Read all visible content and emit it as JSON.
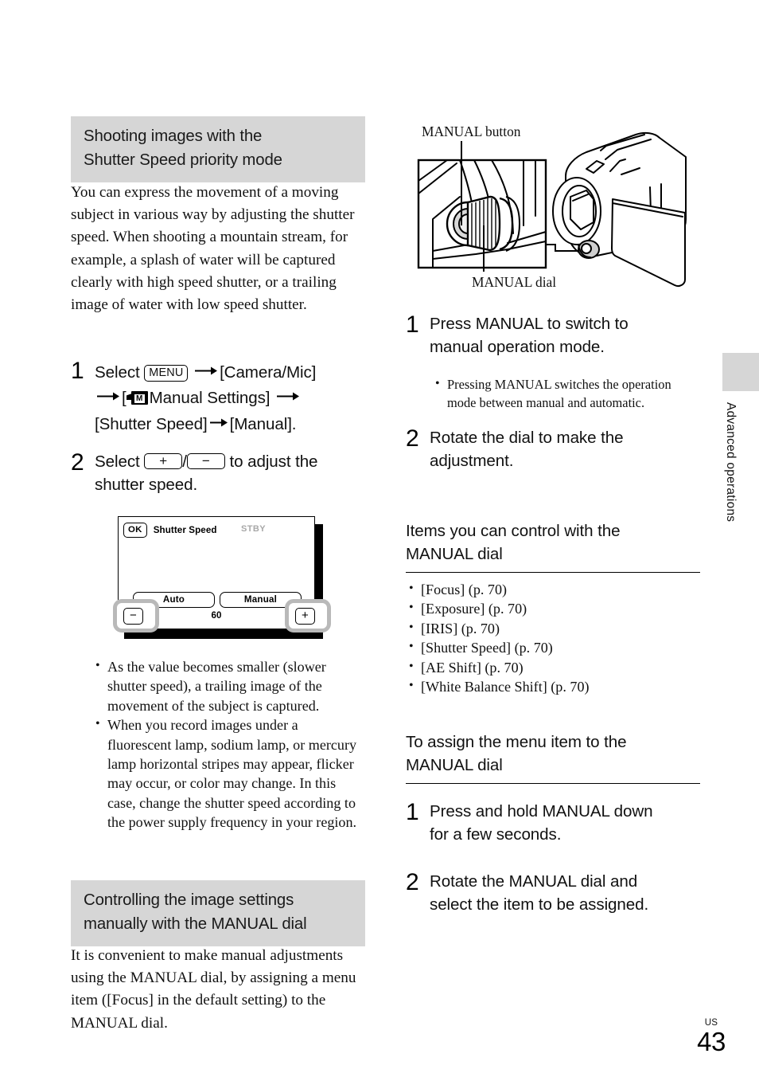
{
  "page": {
    "region": "US",
    "number": "43",
    "side_tab": "Advanced operations"
  },
  "left_column": {
    "heading1": {
      "line1": "Shooting images with the",
      "line2": "Shutter Speed priority mode"
    },
    "intro_paragraph": "You can express the movement of a moving subject in various way by adjusting the shutter speed. When shooting a mountain stream, for example, a splash of water will be captured clearly with high speed shutter, or a trailing image of water with low speed shutter.",
    "steps": [
      {
        "number": "1",
        "select_label": "Select",
        "menu_key": "MENU",
        "item1": "[Camera/Mic]",
        "icon_letter": "M",
        "item2": "Manual Settings]",
        "item3": "[Shutter Speed]",
        "item4": "[Manual]."
      },
      {
        "number": "2",
        "select_label": "Select",
        "plus_key": "+",
        "minus_key": "−",
        "tail_line1": "to adjust the",
        "tail_line2": "shutter speed."
      }
    ],
    "lcd_screen": {
      "ok_button": "OK",
      "title": "Shutter Speed",
      "status": "STBY",
      "mode_auto": "Auto",
      "mode_manual": "Manual",
      "value": "60",
      "decrease_button": "−",
      "increase_button": "+"
    },
    "notes": [
      "As the value becomes smaller (slower shutter speed), a trailing image of the movement of the subject is captured.",
      "When you record images under a fluorescent lamp, sodium lamp, or mercury lamp horizontal stripes may appear, flicker may occur, or color may change. In this case, change the shutter speed according to the power supply frequency in your region."
    ],
    "heading2": {
      "line1": "Controlling the image settings",
      "line2": "manually with the MANUAL dial"
    },
    "closing_paragraph": "It is convenient to make manual adjustments using the MANUAL dial, by assigning a menu item ([Focus] in the default setting) to the MANUAL dial."
  },
  "right_column": {
    "figure": {
      "label_top": "MANUAL button",
      "label_bottom": "MANUAL dial"
    },
    "steps": [
      {
        "number": "1",
        "line1": "Press MANUAL to switch to",
        "line2": "manual operation mode."
      },
      {
        "number": "2",
        "line1": "Rotate the dial to make the",
        "line2": "adjustment."
      }
    ],
    "step1_note": "Pressing MANUAL switches the operation mode between manual and automatic.",
    "items_heading": {
      "line1": "Items you can control with the",
      "line2": "MANUAL dial"
    },
    "items_list": [
      "[Focus] (p. 70)",
      "[Exposure] (p. 70)",
      "[IRIS] (p. 70)",
      "[Shutter Speed] (p. 70)",
      "[AE Shift] (p. 70)",
      "[White Balance Shift] (p. 70)"
    ],
    "assign_heading": {
      "line1": "To assign the menu item to the",
      "line2": "MANUAL dial"
    },
    "assign_steps": [
      {
        "number": "1",
        "line1": "Press and hold MANUAL down",
        "line2": "for a few seconds."
      },
      {
        "number": "2",
        "line1": "Rotate the MANUAL dial and",
        "line2": "select the item to be assigned."
      }
    ]
  },
  "colors": {
    "heading_background": "#d6d6d6",
    "text": "#111111",
    "status_gray": "#a8a8a8"
  }
}
